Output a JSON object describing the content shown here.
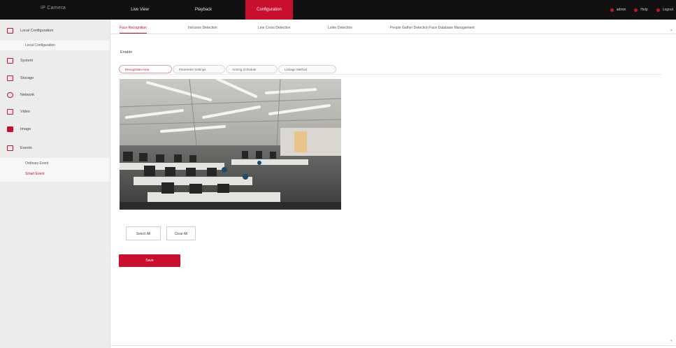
{
  "brand": "IP Camera",
  "nav": {
    "items": [
      {
        "label": "Live View"
      },
      {
        "label": "Playback"
      },
      {
        "label": "Configuration"
      }
    ]
  },
  "top_right": {
    "user": "admin",
    "help": "Help",
    "logout": "Logout"
  },
  "sidebar": {
    "items": [
      {
        "label": "Local Configuration",
        "icon": "monitor-icon"
      },
      {
        "label": "System",
        "icon": "system-icon"
      },
      {
        "label": "Storage",
        "icon": "storage-icon"
      },
      {
        "label": "Network",
        "icon": "network-icon"
      },
      {
        "label": "Video",
        "icon": "video-icon"
      },
      {
        "label": "Image",
        "icon": "image-icon"
      },
      {
        "label": "Events",
        "icon": "events-icon"
      }
    ],
    "sub_local": "Local Configuration",
    "sub_events": [
      {
        "label": "Ordinary Event"
      },
      {
        "label": "Smart Event"
      }
    ]
  },
  "tabs": [
    {
      "label": "Face Recognition"
    },
    {
      "label": "Intrusion Detection"
    },
    {
      "label": "Line Cross Detection"
    },
    {
      "label": "Loiter Detection"
    },
    {
      "label": "People Gather Detection Face Database Management"
    }
  ],
  "section_label": "Enable",
  "pills": [
    {
      "label": "Recognition Area"
    },
    {
      "label": "Parameter Settings"
    },
    {
      "label": "Arming Schedule"
    },
    {
      "label": "Linkage Method"
    }
  ],
  "buttons": {
    "select_all": "Select All",
    "clear_all": "Clear All",
    "save": "Save"
  },
  "colors": {
    "accent": "#c8102e",
    "topbar": "#111111",
    "sidebar": "#ececec"
  }
}
